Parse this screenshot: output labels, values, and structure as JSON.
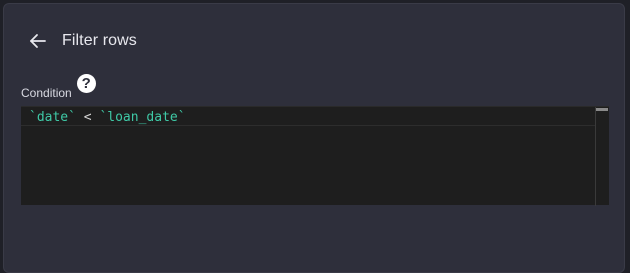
{
  "header": {
    "back_icon": "arrow-left-icon",
    "title": "Filter rows"
  },
  "condition": {
    "label": "Condition",
    "help_icon": "question-circle-icon",
    "help_glyph": "?",
    "code_tokens": {
      "left": "`date`",
      "operator": " < ",
      "right": "`loan_date`"
    }
  },
  "colors": {
    "panel_bg": "#2e2f3b",
    "editor_bg": "#1e1e1e",
    "identifier": "#3fc9a6",
    "text": "#e8e8ee"
  }
}
